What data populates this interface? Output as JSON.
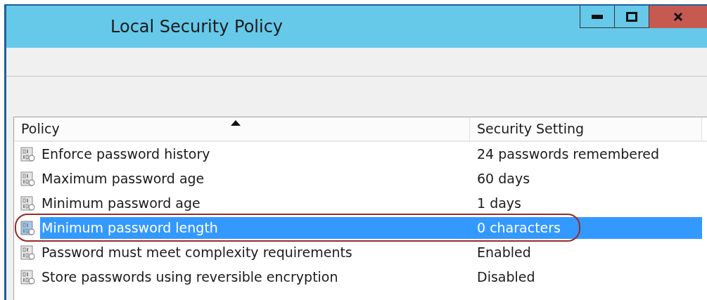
{
  "window": {
    "title": "Local Security Policy"
  },
  "list": {
    "columns": [
      {
        "label": "Policy",
        "sorted": true
      },
      {
        "label": "Security Setting",
        "sorted": false
      }
    ],
    "rows": [
      {
        "policy": "Enforce password history",
        "setting": "24 passwords remembered",
        "selected": false,
        "circled": false
      },
      {
        "policy": "Maximum password age",
        "setting": "60 days",
        "selected": false,
        "circled": false
      },
      {
        "policy": "Minimum password age",
        "setting": "1 days",
        "selected": false,
        "circled": false
      },
      {
        "policy": "Minimum password length",
        "setting": "0 characters",
        "selected": true,
        "circled": true
      },
      {
        "policy": "Password must meet complexity requirements",
        "setting": "Enabled",
        "selected": false,
        "circled": false
      },
      {
        "policy": "Store passwords using reversible encryption",
        "setting": "Disabled",
        "selected": false,
        "circled": false
      }
    ]
  }
}
